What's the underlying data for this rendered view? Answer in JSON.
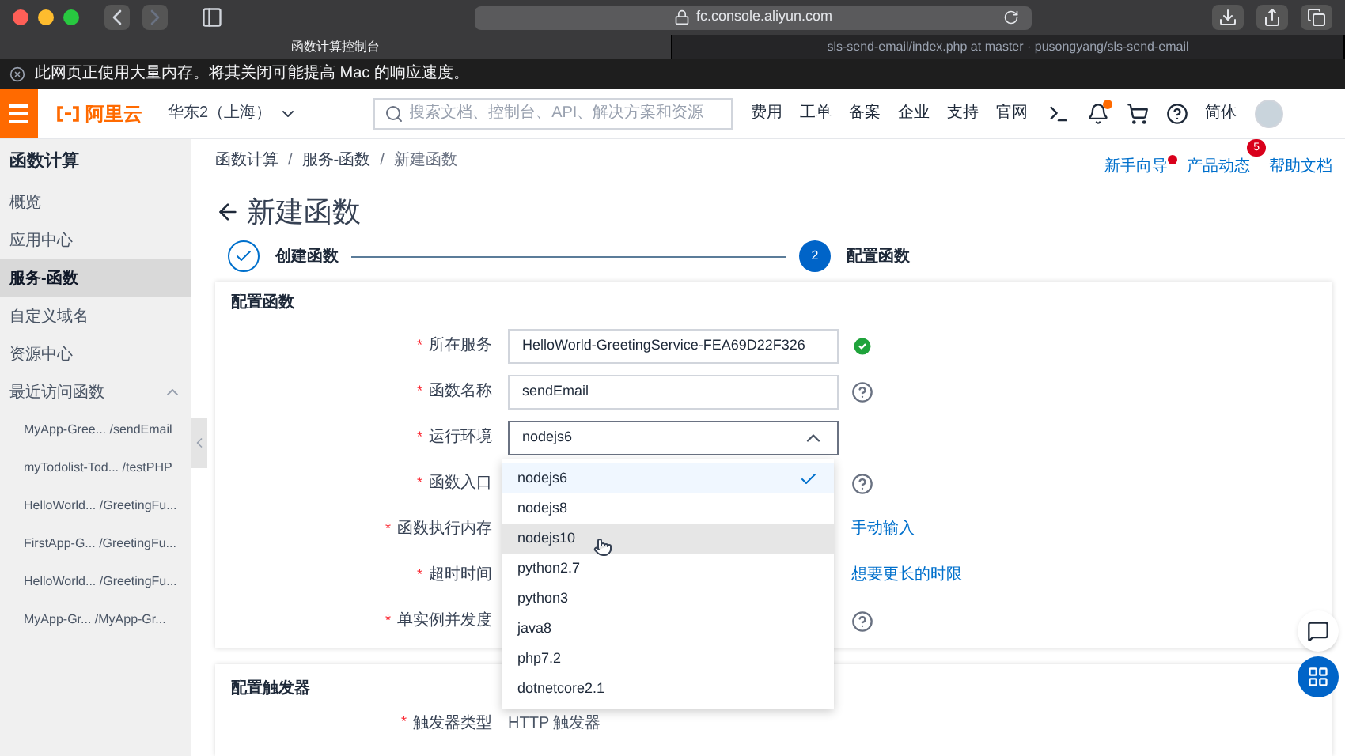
{
  "browser": {
    "url": "fc.console.aliyun.com",
    "tabs": [
      {
        "title": "函数计算控制台",
        "selected": true
      },
      {
        "title": "sls-send-email/index.php at master · pusongyang/sls-send-email",
        "selected": false
      }
    ],
    "notice": "此网页正使用大量内存。将其关闭可能提高 Mac 的响应速度。"
  },
  "header": {
    "logo": "阿里云",
    "region": "华东2（上海）",
    "search": {
      "placeholder": "搜索文档、控制台、API、解决方案和资源"
    },
    "nav": [
      "费用",
      "工单",
      "备案",
      "企业",
      "支持",
      "官网"
    ],
    "language": "简体"
  },
  "sidebar": {
    "title": "函数计算",
    "items": [
      {
        "label": "概览",
        "selected": false
      },
      {
        "label": "应用中心",
        "selected": false
      },
      {
        "label": "服务-函数",
        "selected": true
      },
      {
        "label": "自定义域名",
        "selected": false
      },
      {
        "label": "资源中心",
        "selected": false
      }
    ],
    "recent": {
      "label": "最近访问函数",
      "expanded": true,
      "children": [
        {
          "label": "MyApp-Gree... /sendEmail"
        },
        {
          "label": "myTodolist-Tod... /testPHP"
        },
        {
          "label": "HelloWorld... /GreetingFu..."
        },
        {
          "label": "FirstApp-G... /GreetingFu..."
        },
        {
          "label": "HelloWorld... /GreetingFu..."
        },
        {
          "label": "MyApp-Gr... /MyApp-Gr..."
        }
      ]
    }
  },
  "breadcrumb": {
    "separator": "/",
    "items": [
      "函数计算",
      "服务-函数",
      "新建函数"
    ]
  },
  "top_links": [
    {
      "label": "新手向导",
      "dot": true
    },
    {
      "label": "产品动态",
      "dot": false,
      "count": "5"
    },
    {
      "label": "帮助文档",
      "dot": false
    }
  ],
  "page_title": "新建函数",
  "steps": [
    {
      "label": "创建函数",
      "done": true
    },
    {
      "number": "2",
      "label": "配置函数",
      "done": false
    }
  ],
  "required_mark": "*",
  "function_card": {
    "title": "配置函数",
    "fields": [
      {
        "label": "所在服务",
        "required": true,
        "kind": "input",
        "value": "HelloWorld-GreetingService-FEA69D22F326",
        "valid": true
      },
      {
        "label": "函数名称",
        "required": true,
        "kind": "input",
        "value": "sendEmail",
        "help": true
      },
      {
        "label": "运行环境",
        "required": true,
        "kind": "select",
        "value": "nodejs6"
      },
      {
        "label": "函数入口",
        "required": true,
        "kind": "hidden",
        "help": true
      },
      {
        "label": "函数执行内存",
        "required": true,
        "kind": "hidden",
        "link": "手动输入"
      },
      {
        "label": "超时时间",
        "required": true,
        "kind": "hidden",
        "link": "想要更长的时限"
      },
      {
        "label": "单实例并发度",
        "required": true,
        "kind": "hidden",
        "help": true
      }
    ]
  },
  "runtime_dropdown": {
    "expanded": true,
    "options": [
      {
        "label": "nodejs6",
        "selected": true,
        "hovered": false
      },
      {
        "label": "nodejs8",
        "selected": false,
        "hovered": false
      },
      {
        "label": "nodejs10",
        "selected": false,
        "hovered": true
      },
      {
        "label": "python2.7",
        "selected": false,
        "hovered": false
      },
      {
        "label": "python3",
        "selected": false,
        "hovered": false
      },
      {
        "label": "java8",
        "selected": false,
        "hovered": false
      },
      {
        "label": "php7.2",
        "selected": false,
        "hovered": false
      },
      {
        "label": "dotnetcore2.1",
        "selected": false,
        "hovered": false
      }
    ]
  },
  "trigger_card": {
    "title": "配置触发器",
    "fields": [
      {
        "label": "触发器类型",
        "required": true,
        "value": "HTTP 触发器"
      }
    ]
  }
}
